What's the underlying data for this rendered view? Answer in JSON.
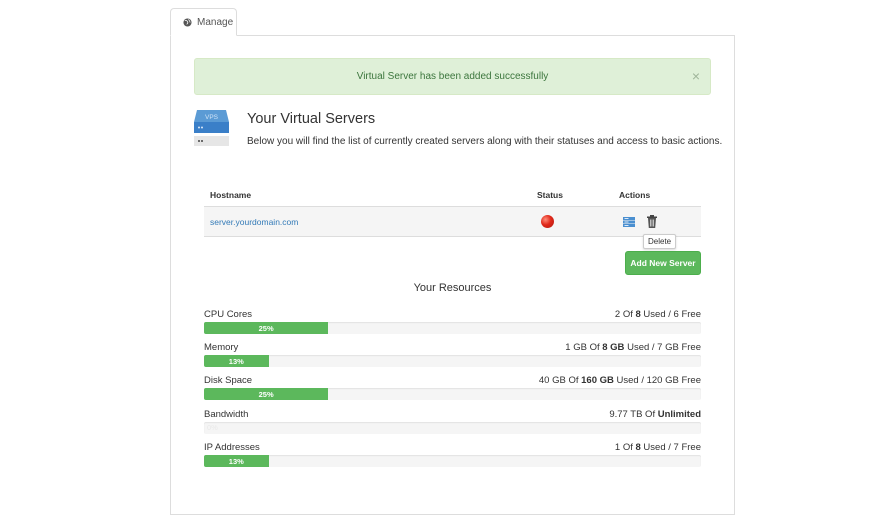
{
  "tab": {
    "label": "Manage",
    "icon": "globe-icon"
  },
  "alert": {
    "message": "Virtual Server has been added successfully",
    "close": "×"
  },
  "header": {
    "icon_text": "VPS",
    "title": "Your Virtual Servers",
    "subtitle": "Below you will find the list of currently created servers along with their statuses and access to basic actions."
  },
  "table": {
    "columns": [
      "Hostname",
      "Status",
      "Actions"
    ],
    "rows": [
      {
        "hostname": "server.yourdomain.com",
        "status": "stopped",
        "status_color": "#e0281a",
        "actions": [
          "manage-icon",
          "delete-icon"
        ]
      }
    ]
  },
  "tooltip": "Delete",
  "add_button": "Add New Server",
  "resources": {
    "title": "Your Resources",
    "accent": "#5cb85c",
    "items": [
      {
        "label": "CPU Cores",
        "pre": "2 Of ",
        "total": "8",
        "post": " Used / 6 Free",
        "percent_label": "25%",
        "percent": 25
      },
      {
        "label": "Memory",
        "pre": "1 GB Of ",
        "total": "8 GB",
        "post": " Used / 7 GB Free",
        "percent_label": "13%",
        "percent": 13
      },
      {
        "label": "Disk Space",
        "pre": "40 GB Of ",
        "total": "160 GB",
        "post": " Used / 120 GB Free",
        "percent_label": "25%",
        "percent": 25
      },
      {
        "label": "Bandwidth",
        "pre": "9.77 TB Of ",
        "total": "Unlimited",
        "post": "",
        "percent_label": "0%",
        "percent": 0
      },
      {
        "label": "IP Addresses",
        "pre": "1 Of ",
        "total": "8",
        "post": " Used / 7 Free",
        "percent_label": "13%",
        "percent": 13
      }
    ]
  }
}
